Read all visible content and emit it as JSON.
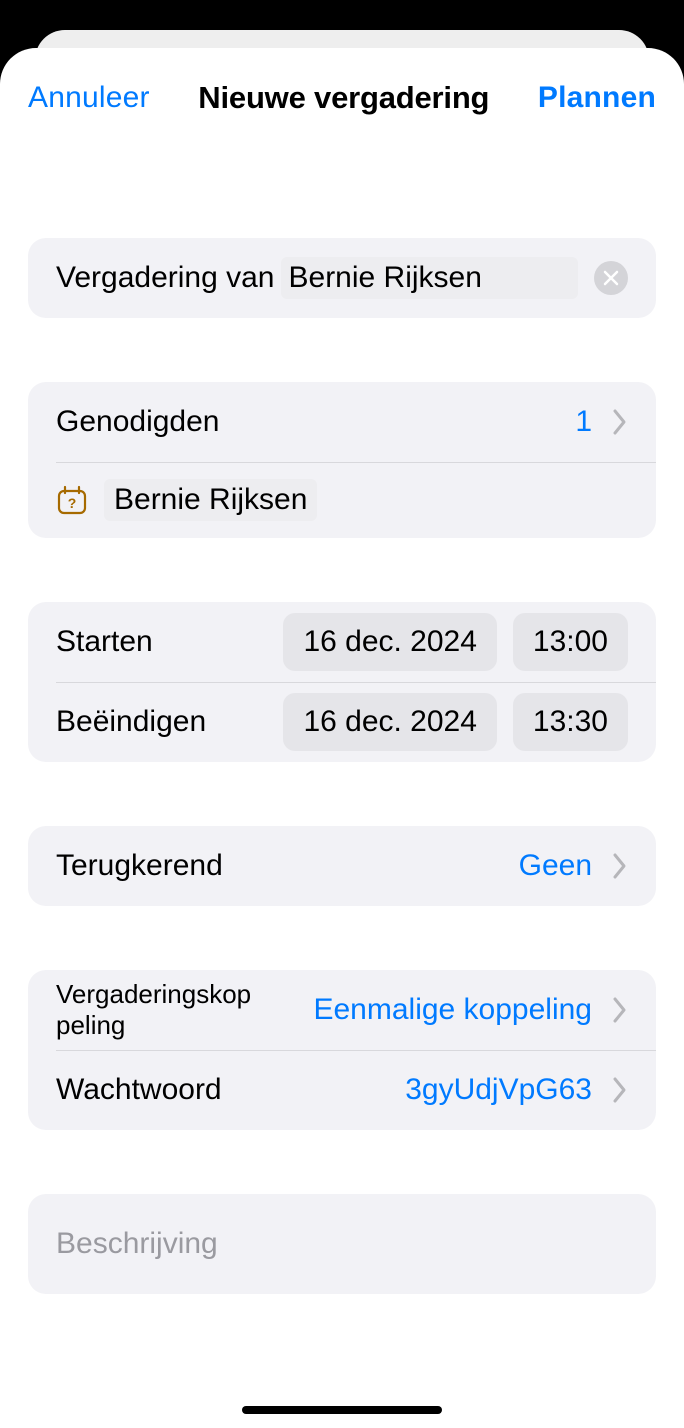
{
  "nav": {
    "cancel": "Annuleer",
    "title": "Nieuwe vergadering",
    "plan": "Plannen"
  },
  "meetingTitle": {
    "prefix": "Vergadering van",
    "name": "Bernie Rijksen"
  },
  "invitees": {
    "label": "Genodigden",
    "count": "1",
    "chip": "Bernie Rijksen"
  },
  "start": {
    "label": "Starten",
    "date": "16 dec. 2024",
    "time": "13:00"
  },
  "end": {
    "label": "Beëindigen",
    "date": "16 dec. 2024",
    "time": "13:30"
  },
  "recurring": {
    "label": "Terugkerend",
    "value": "Geen"
  },
  "link": {
    "label": "Vergaderingskoppeling",
    "value": "Eenmalige koppeling"
  },
  "password": {
    "label": "Wachtwoord",
    "value": "3gyUdjVpG63"
  },
  "description": {
    "placeholder": "Beschrijving"
  }
}
